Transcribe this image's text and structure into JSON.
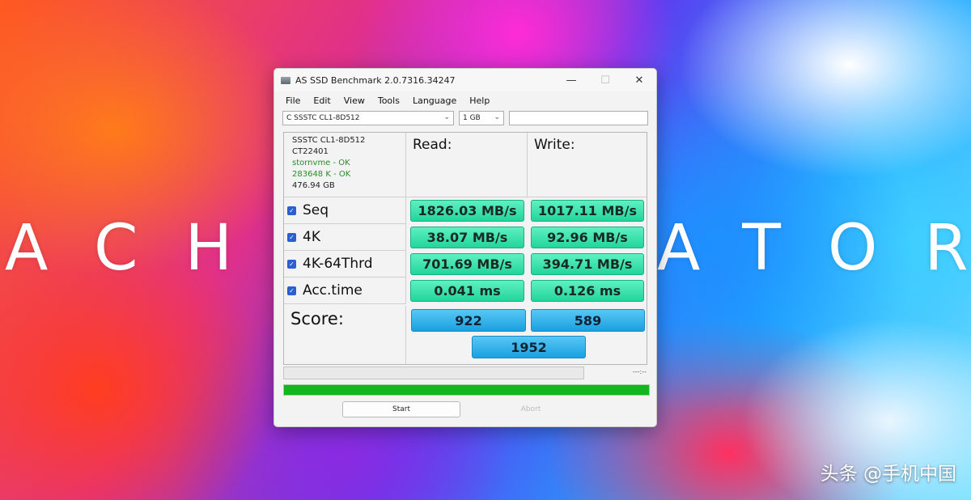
{
  "background": {
    "word_left": "ACH",
    "word_right": "ATOR",
    "watermark": "头条 @手机中国"
  },
  "window": {
    "title": "AS SSD Benchmark 2.0.7316.34247",
    "controls": {
      "minimize": "—",
      "maximize": "☐",
      "close": "✕"
    },
    "menu": [
      "File",
      "Edit",
      "View",
      "Tools",
      "Language",
      "Help"
    ],
    "drive_select": "C  SSSTC CL1-8D512",
    "size_select": "1 GB",
    "info": {
      "model": "SSSTC CL1-8D512",
      "firmware": "CT22401",
      "driver": "stornvme - OK",
      "alignment": "283648 K - OK",
      "capacity": "476.94 GB"
    },
    "columns": {
      "read": "Read:",
      "write": "Write:"
    },
    "rows": [
      {
        "label": "Seq",
        "read": "1826.03 MB/s",
        "write": "1017.11 MB/s"
      },
      {
        "label": "4K",
        "read": "38.07 MB/s",
        "write": "92.96 MB/s"
      },
      {
        "label": "4K-64Thrd",
        "read": "701.69 MB/s",
        "write": "394.71 MB/s"
      },
      {
        "label": "Acc.time",
        "read": "0.041 ms",
        "write": "0.126 ms"
      }
    ],
    "score": {
      "label": "Score:",
      "read": "922",
      "write": "589",
      "total": "1952"
    },
    "elapsed": "---:--",
    "progress_fraction": 1.0,
    "buttons": {
      "start": "Start",
      "abort": "Abort"
    },
    "colors": {
      "result_green": "#22d59a",
      "score_blue": "#1aa0e0",
      "progress_green": "#14b61f"
    }
  }
}
